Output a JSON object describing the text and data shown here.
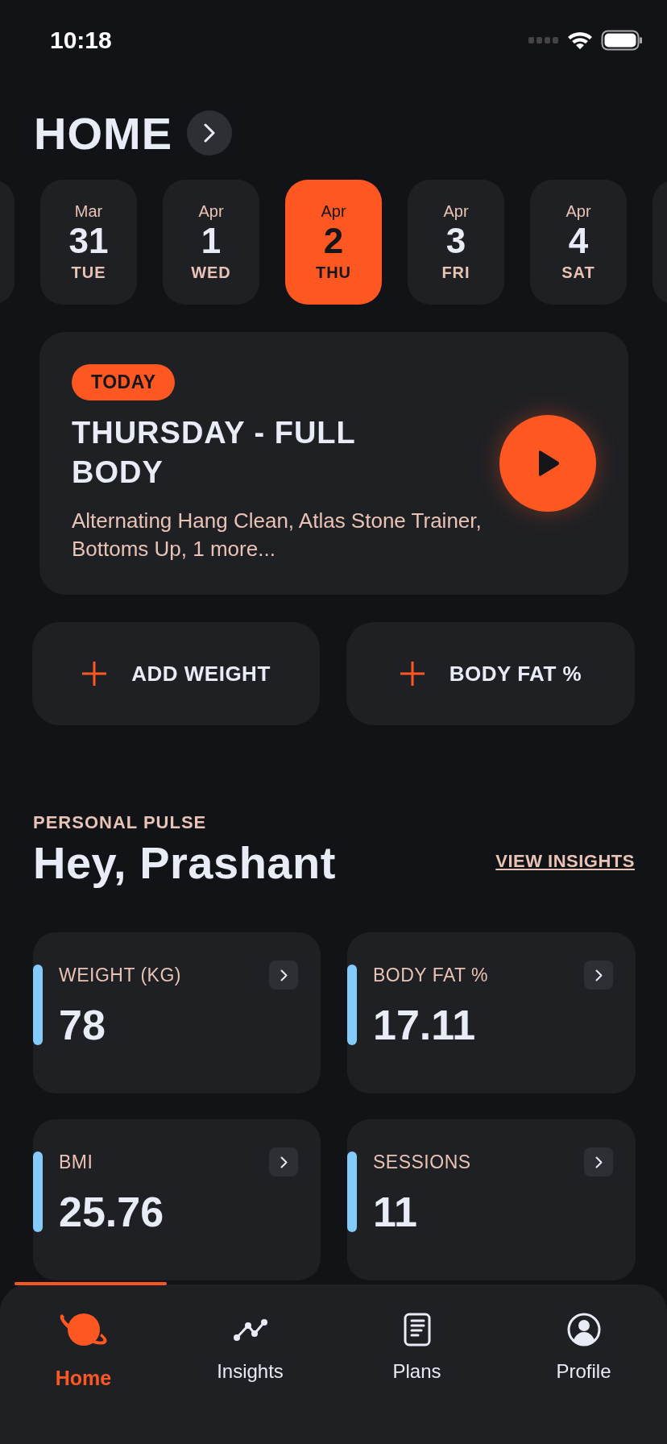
{
  "status_bar": {
    "time": "10:18"
  },
  "header": {
    "title": "HOME"
  },
  "days": [
    {
      "month": "Mar",
      "day": "31",
      "weekday": "TUE",
      "selected": false
    },
    {
      "month": "Apr",
      "day": "1",
      "weekday": "WED",
      "selected": false
    },
    {
      "month": "Apr",
      "day": "2",
      "weekday": "THU",
      "selected": true
    },
    {
      "month": "Apr",
      "day": "3",
      "weekday": "FRI",
      "selected": false
    },
    {
      "month": "Apr",
      "day": "4",
      "weekday": "SAT",
      "selected": false
    }
  ],
  "today_card": {
    "badge": "TODAY",
    "title": "THURSDAY - FULL BODY",
    "exercises": "Alternating Hang Clean, Atlas Stone Trainer, Bottoms Up, 1 more..."
  },
  "quick_actions": [
    {
      "label": "ADD WEIGHT"
    },
    {
      "label": "BODY FAT %"
    }
  ],
  "pulse": {
    "eyebrow": "PERSONAL PULSE",
    "greeting": "Hey, Prashant",
    "link": "VIEW INSIGHTS"
  },
  "stats": [
    {
      "label": "WEIGHT (KG)",
      "value": "78"
    },
    {
      "label": "BODY FAT %",
      "value": "17.11"
    },
    {
      "label": "BMI",
      "value": "25.76"
    },
    {
      "label": "SESSIONS",
      "value": "11"
    }
  ],
  "tab_bar": [
    {
      "label": "Home",
      "selected": true
    },
    {
      "label": "Insights",
      "selected": false
    },
    {
      "label": "Plans",
      "selected": false
    },
    {
      "label": "Profile",
      "selected": false
    }
  ]
}
